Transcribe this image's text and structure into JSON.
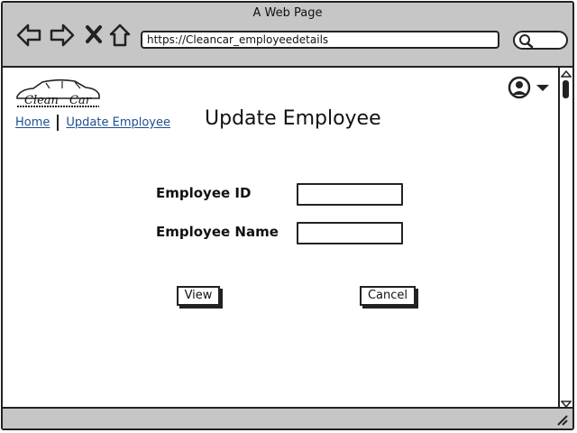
{
  "browser": {
    "title": "A Web Page",
    "url": "https://Cleancar_employeedetails"
  },
  "logo": {
    "brand": "Clean Car"
  },
  "breadcrumb": {
    "home": "Home",
    "current": "Update Employee"
  },
  "page": {
    "title": "Update Employee"
  },
  "form": {
    "employee_id_label": "Employee ID",
    "employee_id_value": "",
    "employee_name_label": "Employee Name",
    "employee_name_value": ""
  },
  "buttons": {
    "view": "View",
    "cancel": "Cancel"
  }
}
